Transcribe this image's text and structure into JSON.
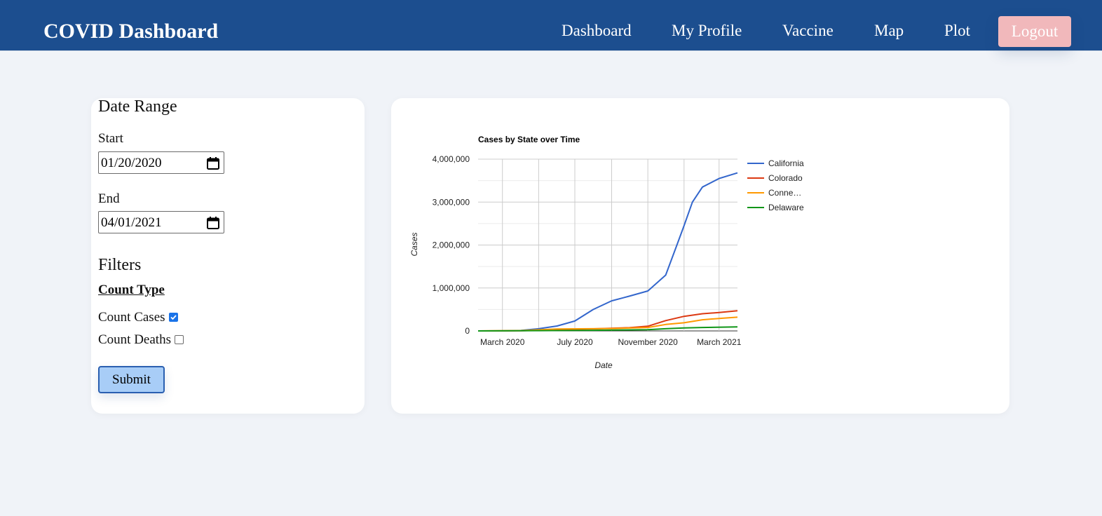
{
  "header": {
    "brand": "COVID Dashboard",
    "nav": [
      "Dashboard",
      "My Profile",
      "Vaccine",
      "Map",
      "Plot"
    ],
    "logout_label": "Logout",
    "colors": {
      "navbar": "#1c4e8f",
      "logout": "#f1b8bb"
    }
  },
  "filters": {
    "date_range_heading": "Date Range",
    "start_label": "Start",
    "start_value": "01/20/2020",
    "end_label": "End",
    "end_value": "04/01/2021",
    "filters_heading": "Filters",
    "count_type_heading": "Count Type",
    "count_cases_label": "Count Cases",
    "count_cases_checked": true,
    "count_deaths_label": "Count Deaths",
    "count_deaths_checked": false,
    "submit_label": "Submit"
  },
  "chart_data": {
    "type": "line",
    "title": "Cases by State over Time",
    "xlabel": "Date",
    "ylabel": "Cases",
    "xlim": [
      "2020-01-20",
      "2021-04-01"
    ],
    "ylim": [
      0,
      4000000
    ],
    "y_ticks": [
      0,
      1000000,
      2000000,
      3000000,
      4000000
    ],
    "y_tick_labels": [
      "0",
      "1,000,000",
      "2,000,000",
      "3,000,000",
      "4,000,000"
    ],
    "x_ticks": [
      "2020-03-01",
      "2020-07-01",
      "2020-11-01",
      "2021-03-01"
    ],
    "x_tick_labels": [
      "March 2020",
      "July 2020",
      "November 2020",
      "March 2021"
    ],
    "legend_position": "right",
    "grid": true,
    "series": [
      {
        "name": "California",
        "legend_label": "California",
        "color": "#3366cc",
        "points": [
          [
            "2020-01-20",
            0
          ],
          [
            "2020-03-01",
            100
          ],
          [
            "2020-04-01",
            10000
          ],
          [
            "2020-05-01",
            50000
          ],
          [
            "2020-06-01",
            115000
          ],
          [
            "2020-07-01",
            230000
          ],
          [
            "2020-08-01",
            500000
          ],
          [
            "2020-09-01",
            700000
          ],
          [
            "2020-10-01",
            810000
          ],
          [
            "2020-11-01",
            930000
          ],
          [
            "2020-12-01",
            1300000
          ],
          [
            "2020-12-20",
            2000000
          ],
          [
            "2021-01-01",
            2450000
          ],
          [
            "2021-01-15",
            3000000
          ],
          [
            "2021-02-01",
            3350000
          ],
          [
            "2021-03-01",
            3550000
          ],
          [
            "2021-04-01",
            3680000
          ]
        ]
      },
      {
        "name": "Colorado",
        "legend_label": "Colorado",
        "color": "#dc3912",
        "points": [
          [
            "2020-01-20",
            0
          ],
          [
            "2020-04-01",
            3000
          ],
          [
            "2020-07-01",
            35000
          ],
          [
            "2020-10-01",
            75000
          ],
          [
            "2020-11-01",
            110000
          ],
          [
            "2020-12-01",
            240000
          ],
          [
            "2021-01-01",
            340000
          ],
          [
            "2021-02-01",
            400000
          ],
          [
            "2021-03-01",
            430000
          ],
          [
            "2021-04-01",
            470000
          ]
        ]
      },
      {
        "name": "Connecticut",
        "legend_label": "Conne…",
        "color": "#ff9900",
        "points": [
          [
            "2020-01-20",
            0
          ],
          [
            "2020-04-01",
            8000
          ],
          [
            "2020-06-01",
            45000
          ],
          [
            "2020-09-01",
            55000
          ],
          [
            "2020-11-01",
            80000
          ],
          [
            "2020-12-01",
            150000
          ],
          [
            "2021-01-01",
            190000
          ],
          [
            "2021-02-01",
            260000
          ],
          [
            "2021-03-01",
            290000
          ],
          [
            "2021-04-01",
            320000
          ]
        ]
      },
      {
        "name": "Delaware",
        "legend_label": "Delaware",
        "color": "#109618",
        "points": [
          [
            "2020-01-20",
            0
          ],
          [
            "2020-05-01",
            7000
          ],
          [
            "2020-08-01",
            15000
          ],
          [
            "2020-11-01",
            28000
          ],
          [
            "2020-12-01",
            50000
          ],
          [
            "2021-01-01",
            70000
          ],
          [
            "2021-02-01",
            80000
          ],
          [
            "2021-04-01",
            95000
          ]
        ]
      }
    ]
  }
}
